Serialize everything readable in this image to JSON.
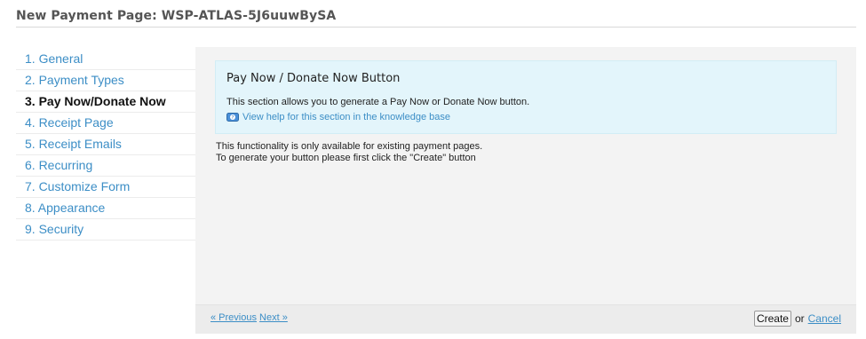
{
  "page": {
    "title": "New Payment Page: WSP-ATLAS-5J6uuwBySA"
  },
  "sidebar": {
    "items": [
      {
        "label": "1. General",
        "active": false
      },
      {
        "label": "2. Payment Types",
        "active": false
      },
      {
        "label": "3. Pay Now/Donate Now",
        "active": true
      },
      {
        "label": "4. Receipt Page",
        "active": false
      },
      {
        "label": "5. Receipt Emails",
        "active": false
      },
      {
        "label": "6. Recurring",
        "active": false
      },
      {
        "label": "7. Customize Form",
        "active": false
      },
      {
        "label": "8. Appearance",
        "active": false
      },
      {
        "label": "9. Security",
        "active": false
      }
    ]
  },
  "info": {
    "title": "Pay Now / Donate Now Button",
    "description": "This section allows you to generate a Pay Now or Donate Now button.",
    "help_link": "View help for this section in the knowledge base",
    "help_icon": "help-icon"
  },
  "notice": {
    "line1": "This functionality is only available for existing payment pages.",
    "line2": "To generate your button please first click the \"Create\" button"
  },
  "footer": {
    "previous_label": "« Previous",
    "next_label": "Next »",
    "create_label": "Create",
    "or_label": "or",
    "cancel_label": "Cancel"
  },
  "colors": {
    "link": "#3c8ec6",
    "info_bg": "#e3f5fb",
    "panel_bg": "#f3f3f3"
  }
}
